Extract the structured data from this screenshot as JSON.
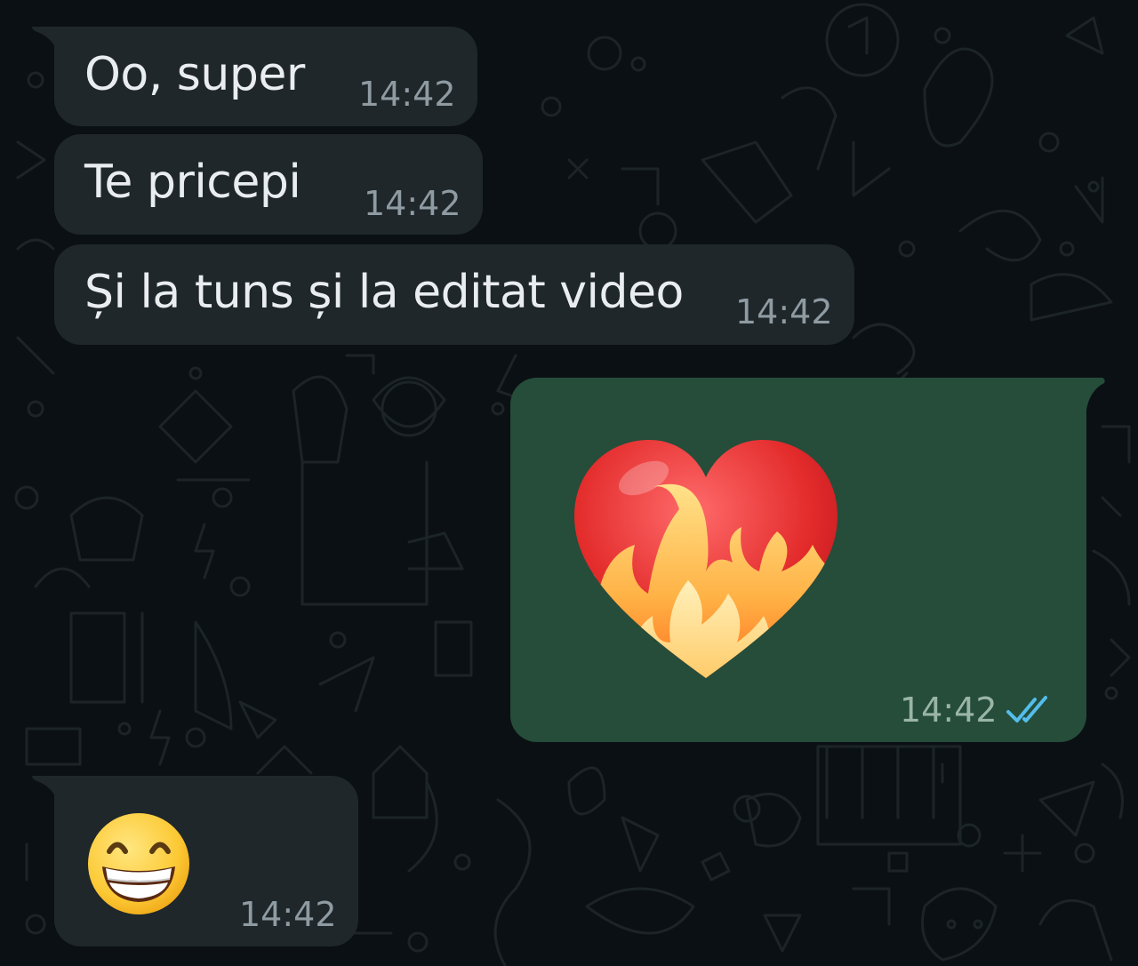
{
  "messages": [
    {
      "id": 1,
      "direction": "incoming",
      "text": "Oo, super",
      "time": "14:42"
    },
    {
      "id": 2,
      "direction": "incoming",
      "text": "Te pricepi",
      "time": "14:42"
    },
    {
      "id": 3,
      "direction": "incoming",
      "text": "Și la tuns și la editat video",
      "time": "14:42"
    },
    {
      "id": 4,
      "direction": "outgoing",
      "emoji": "heart-on-fire",
      "time": "14:42",
      "status": "read"
    },
    {
      "id": 5,
      "direction": "incoming",
      "emoji": "grinning-face-with-smiling-eyes",
      "time": "14:42"
    }
  ],
  "colors": {
    "background": "#0b1014",
    "incoming_bubble": "#1f272b",
    "outgoing_bubble": "#254d3a",
    "text": "#e9edef",
    "timestamp": "#8f9ba2",
    "read_ticks": "#53bdeb"
  }
}
